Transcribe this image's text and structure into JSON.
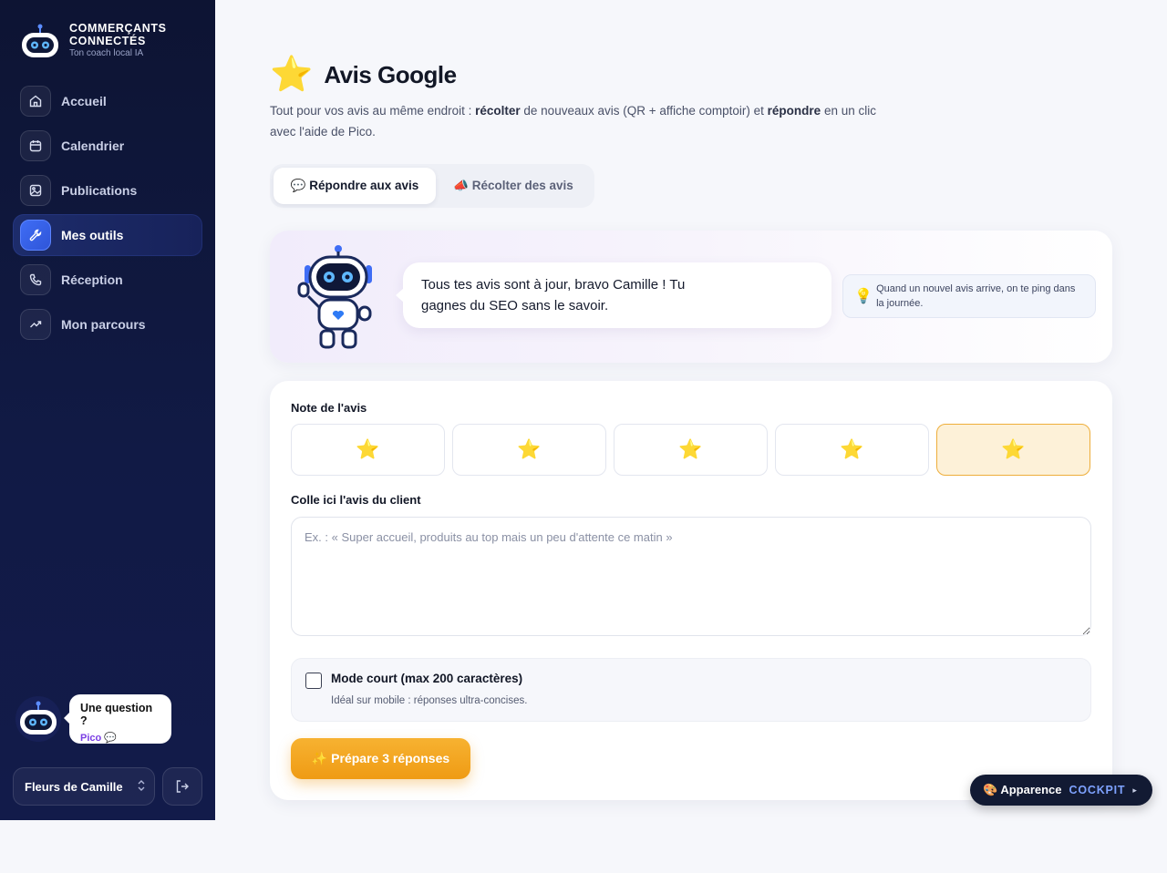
{
  "brand": {
    "title_line1": "Commerçants",
    "title_line2": "Connectés",
    "subtitle": "Ton coach local IA"
  },
  "nav": {
    "items": [
      {
        "label": "Accueil",
        "icon": "home-icon"
      },
      {
        "label": "Calendrier",
        "icon": "calendar-icon"
      },
      {
        "label": "Publications",
        "icon": "image-icon"
      },
      {
        "label": "Mes outils",
        "icon": "wrench-icon",
        "active": true
      },
      {
        "label": "Réception",
        "icon": "phone-icon"
      },
      {
        "label": "Mon parcours",
        "icon": "trend-icon"
      }
    ]
  },
  "helper": {
    "question": "Une question ?",
    "name": "Pico 💬"
  },
  "account": {
    "name": "Fleurs de Camille"
  },
  "page": {
    "title_icon": "⭐",
    "title": "Avis Google",
    "intro_1": "Tout pour vos avis au même endroit : ",
    "intro_b1": "récolter",
    "intro_2": " de nouveaux avis (QR + affiche comptoir) et ",
    "intro_b2": "répondre",
    "intro_3": " en un clic avec l'aide de Pico."
  },
  "tabs": {
    "reply": "💬 Répondre aux avis",
    "collect": "📣 Récolter des avis"
  },
  "hero": {
    "message": "Tous tes avis sont à jour, bravo Camille ! Tu gagnes du SEO sans le savoir.",
    "tip_icon": "💡",
    "tip": "Quand un nouvel avis arrive, on te ping dans la journée."
  },
  "form": {
    "rating_label": "Note de l'avis",
    "star_glyph": "⭐",
    "rating_selected": 5,
    "rating_max": 5,
    "review_label": "Colle ici l'avis du client",
    "review_placeholder": "Ex. : « Super accueil, produits au top mais un peu d'attente ce matin »",
    "short_mode_title": "Mode court (max 200 caractères)",
    "short_mode_desc": "Idéal sur mobile : réponses ultra-concises.",
    "submit": "✨ Prépare 3 réponses"
  },
  "appearance": {
    "label": "🎨 Apparence",
    "mode": "COCKPIT",
    "arrow": "▸"
  },
  "colors": {
    "accent": "#ef9b14",
    "sidebar": "#0d1433",
    "active_nav": "#3f6df5"
  }
}
